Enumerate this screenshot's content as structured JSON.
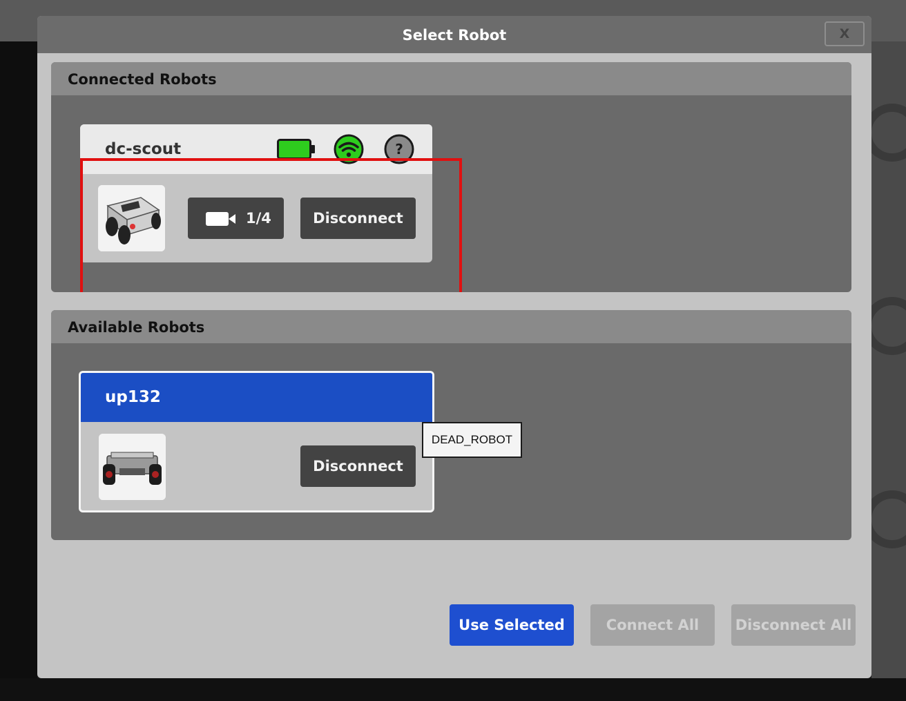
{
  "dialog": {
    "title": "Select Robot",
    "close_label": "X"
  },
  "connected": {
    "heading": "Connected Robots",
    "robot": {
      "name": "dc-scout",
      "battery_icon": "battery-full-icon",
      "wifi_icon": "wifi-icon",
      "help_icon": "help-icon",
      "help_glyph": "?",
      "camera_label": "1/4",
      "disconnect_label": "Disconnect"
    }
  },
  "available": {
    "heading": "Available Robots",
    "robot": {
      "name": "up132",
      "disconnect_label": "Disconnect",
      "tooltip": "DEAD_ROBOT"
    }
  },
  "footer": {
    "use_selected": "Use Selected",
    "connect_all": "Connect All",
    "disconnect_all": "Disconnect All"
  },
  "colors": {
    "accent_blue": "#1e4fd0",
    "selected_card_head": "#1b4ec4",
    "status_green": "#2ecc1e",
    "highlight_red": "#e01010"
  }
}
